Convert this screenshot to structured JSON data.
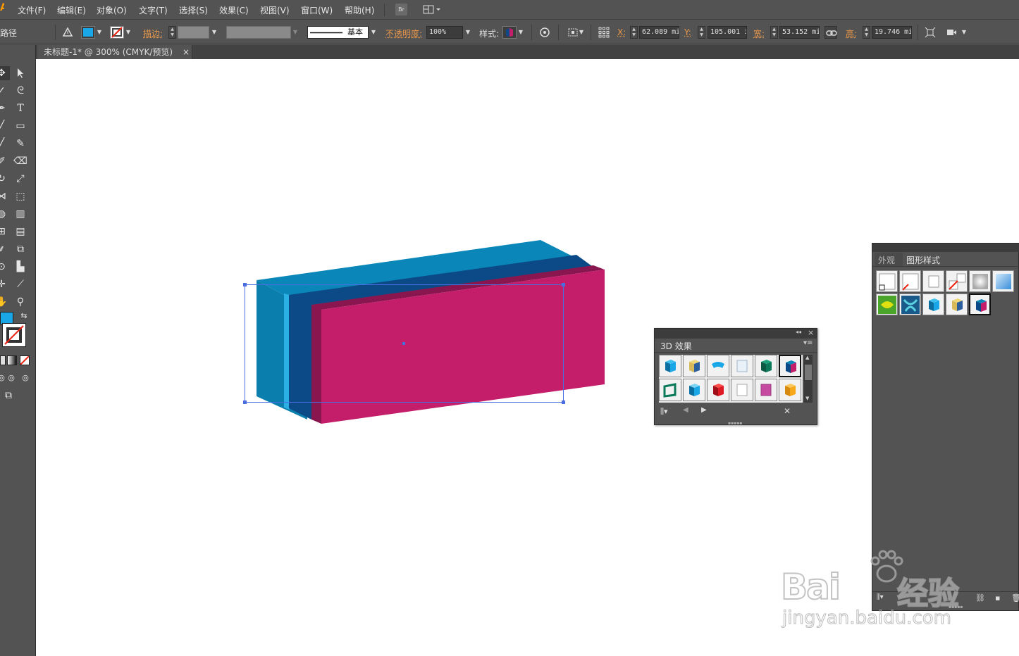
{
  "app": {
    "menu": [
      "文件(F)",
      "编辑(E)",
      "对象(O)",
      "文字(T)",
      "选择(S)",
      "效果(C)",
      "视图(V)",
      "窗口(W)",
      "帮助(H)"
    ],
    "bridge_button": "Br"
  },
  "controlbar": {
    "selection_type": "路径",
    "stroke_label": "描边:",
    "stroke_profile": "基本",
    "opacity_label": "不透明度:",
    "opacity_value": "100%",
    "style_label": "样式:",
    "x_label": "X:",
    "x_value": "62.089 mi",
    "y_label": "Y:",
    "y_value": "105.001 i",
    "w_label": "宽:",
    "w_value": "53.152 mi",
    "h_label": "高:",
    "h_value": "19.746 mi",
    "fill_color": "#1aa7e8"
  },
  "document": {
    "tab_title": "未标题-1* @ 300% (CMYK/预览)",
    "tab_close": "×"
  },
  "artwork": {
    "colors": {
      "top_blue": "#0a87b8",
      "left_blue": "#0a7eac",
      "light_blue_edge": "#2bb0e6",
      "dark_blue": "#0b4a86",
      "magenta_front": "#c41e6a",
      "magenta_dark": "#8a164f",
      "selection": "#4a6ee0"
    }
  },
  "panel_3d": {
    "tab_label": "3D 效果",
    "collapse_icon": "◂◂",
    "close_icon": "×",
    "menu_icon": "≡"
  },
  "panel_styles": {
    "tab_appearance": "外观",
    "tab_graphic_styles": "图形样式"
  },
  "watermark": {
    "brand": "Bai",
    "brand_cn": "经验",
    "url": "jingyan.baidu.com"
  }
}
